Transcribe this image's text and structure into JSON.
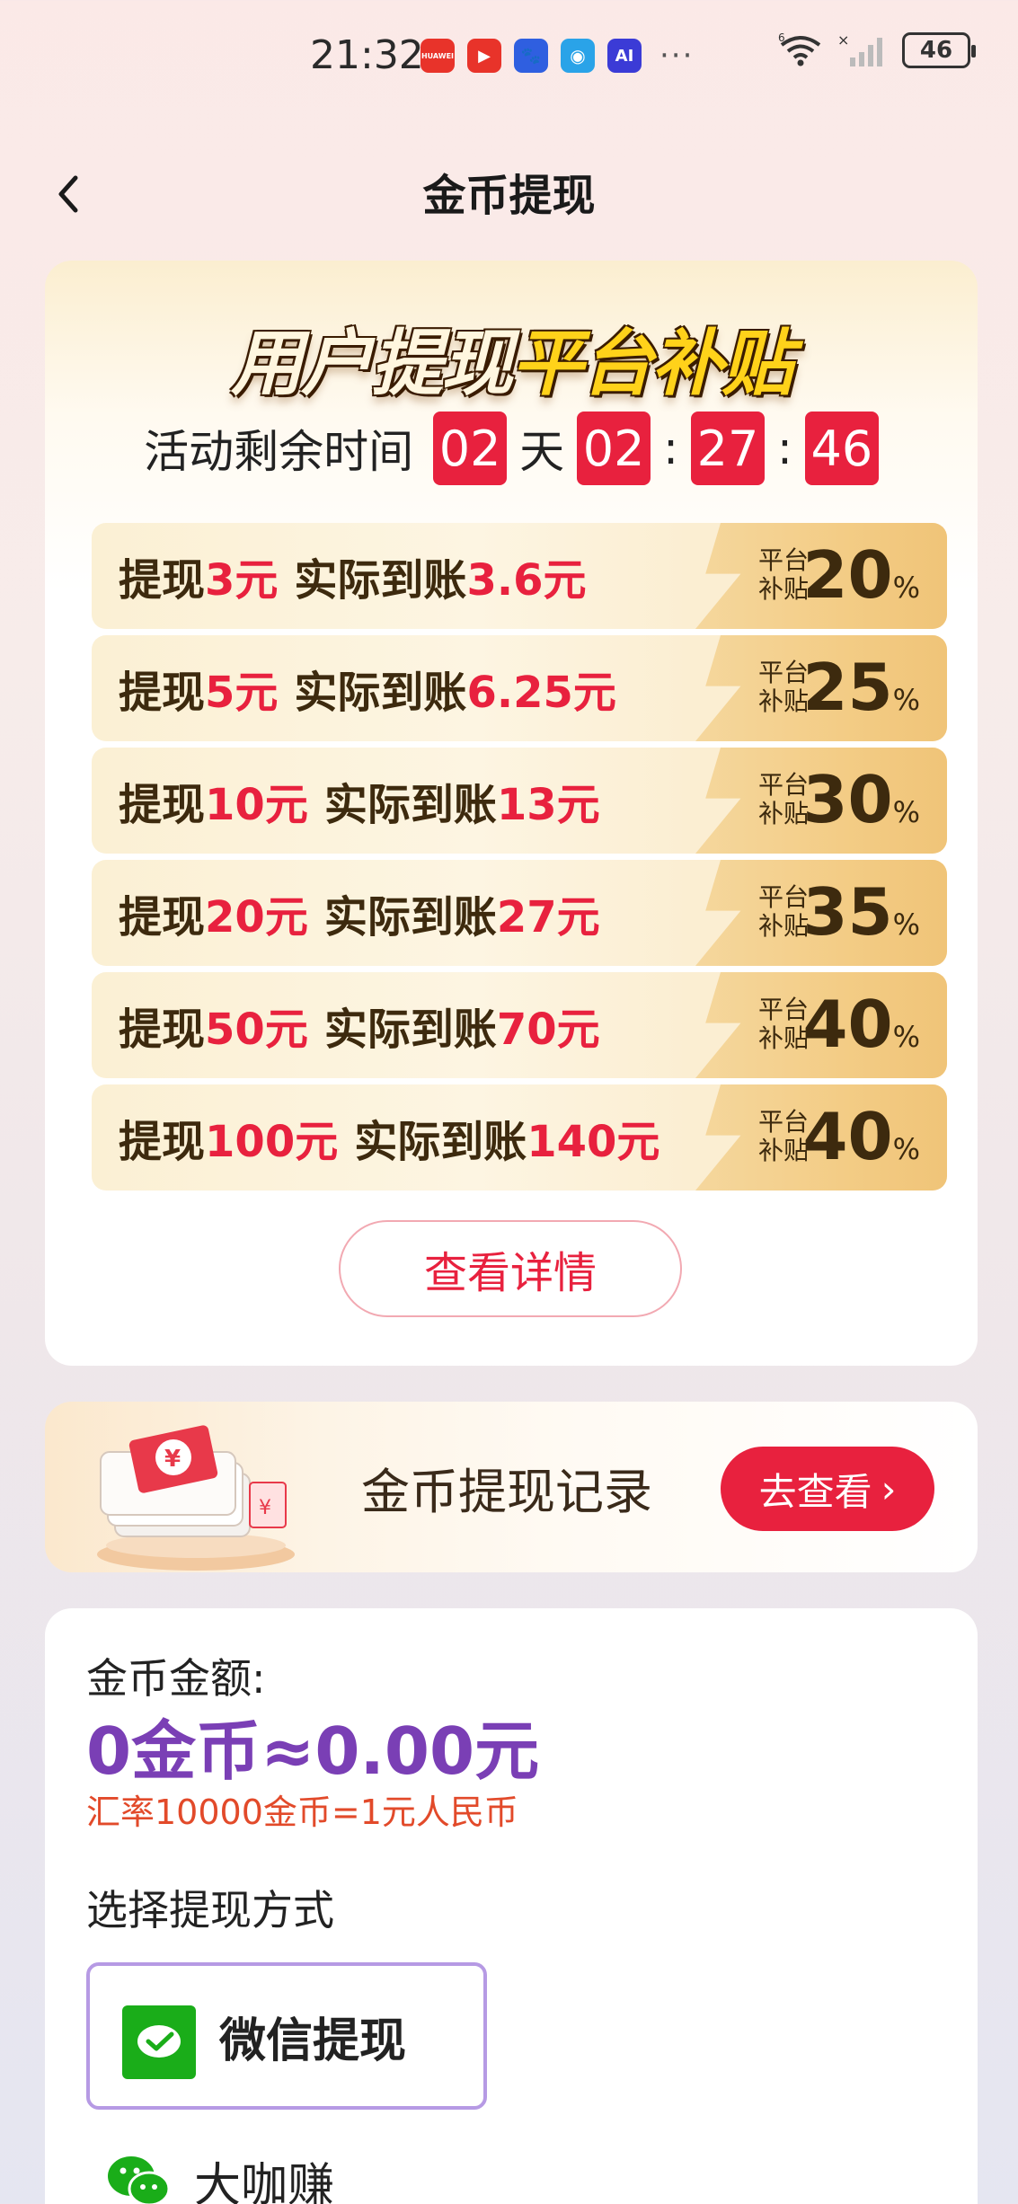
{
  "status_bar": {
    "time": "21:32",
    "apps": [
      {
        "name": "huawei-app-icon",
        "text": "HUAWEI",
        "color": "#e8332a"
      },
      {
        "name": "video-app-icon",
        "text": "▶",
        "color": "#e8332a"
      },
      {
        "name": "baidu-app-icon",
        "text": "🐾",
        "color": "#ffffff"
      },
      {
        "name": "browser-app-icon",
        "text": "◉",
        "color": "#ffffff"
      },
      {
        "name": "ai-app-icon",
        "text": "AI",
        "color": "#3b3bd6"
      }
    ],
    "more": "···",
    "network": "6",
    "battery": "46"
  },
  "header": {
    "title": "金币提现"
  },
  "promo": {
    "title_part1": "用户提现",
    "title_part2": "平台补贴",
    "countdown": {
      "label": "活动剩余时间",
      "days": "02",
      "day_unit": "天",
      "hours": "02",
      "minutes": "27",
      "seconds": "46",
      "sep": ":"
    },
    "tiers": [
      {
        "w_pre": "提现",
        "w_amt": "3元",
        "r_pre": "实际到账",
        "r_amt": "3.6元",
        "sub1": "平台",
        "sub2": "补贴",
        "pct": "20",
        "pct_sign": "%"
      },
      {
        "w_pre": "提现",
        "w_amt": "5元",
        "r_pre": "实际到账",
        "r_amt": "6.25元",
        "sub1": "平台",
        "sub2": "补贴",
        "pct": "25",
        "pct_sign": "%"
      },
      {
        "w_pre": "提现",
        "w_amt": "10元",
        "r_pre": "实际到账",
        "r_amt": "13元",
        "sub1": "平台",
        "sub2": "补贴",
        "pct": "30",
        "pct_sign": "%"
      },
      {
        "w_pre": "提现",
        "w_amt": "20元",
        "r_pre": "实际到账",
        "r_amt": "27元",
        "sub1": "平台",
        "sub2": "补贴",
        "pct": "35",
        "pct_sign": "%"
      },
      {
        "w_pre": "提现",
        "w_amt": "50元",
        "r_pre": "实际到账",
        "r_amt": "70元",
        "sub1": "平台",
        "sub2": "补贴",
        "pct": "40",
        "pct_sign": "%"
      },
      {
        "w_pre": "提现",
        "w_amt": "100元",
        "r_pre": "实际到账",
        "r_amt": "140元",
        "sub1": "平台",
        "sub2": "补贴",
        "pct": "40",
        "pct_sign": "%"
      }
    ],
    "detail_button": "查看详情"
  },
  "record": {
    "title": "金币提现记录",
    "button": "去查看",
    "button_arrow": "›"
  },
  "balance": {
    "label": "金币金额:",
    "value": "0金币≈0.00元",
    "rate": "汇率10000金币=1元人民币",
    "method_label": "选择提现方式",
    "wechat_option": "微信提现",
    "other_option": "大咖赚"
  },
  "colors": {
    "accent_red": "#e8213e",
    "purple": "#7a3fb5",
    "wechat_green": "#1aad19",
    "option_border": "#b69ae4"
  }
}
